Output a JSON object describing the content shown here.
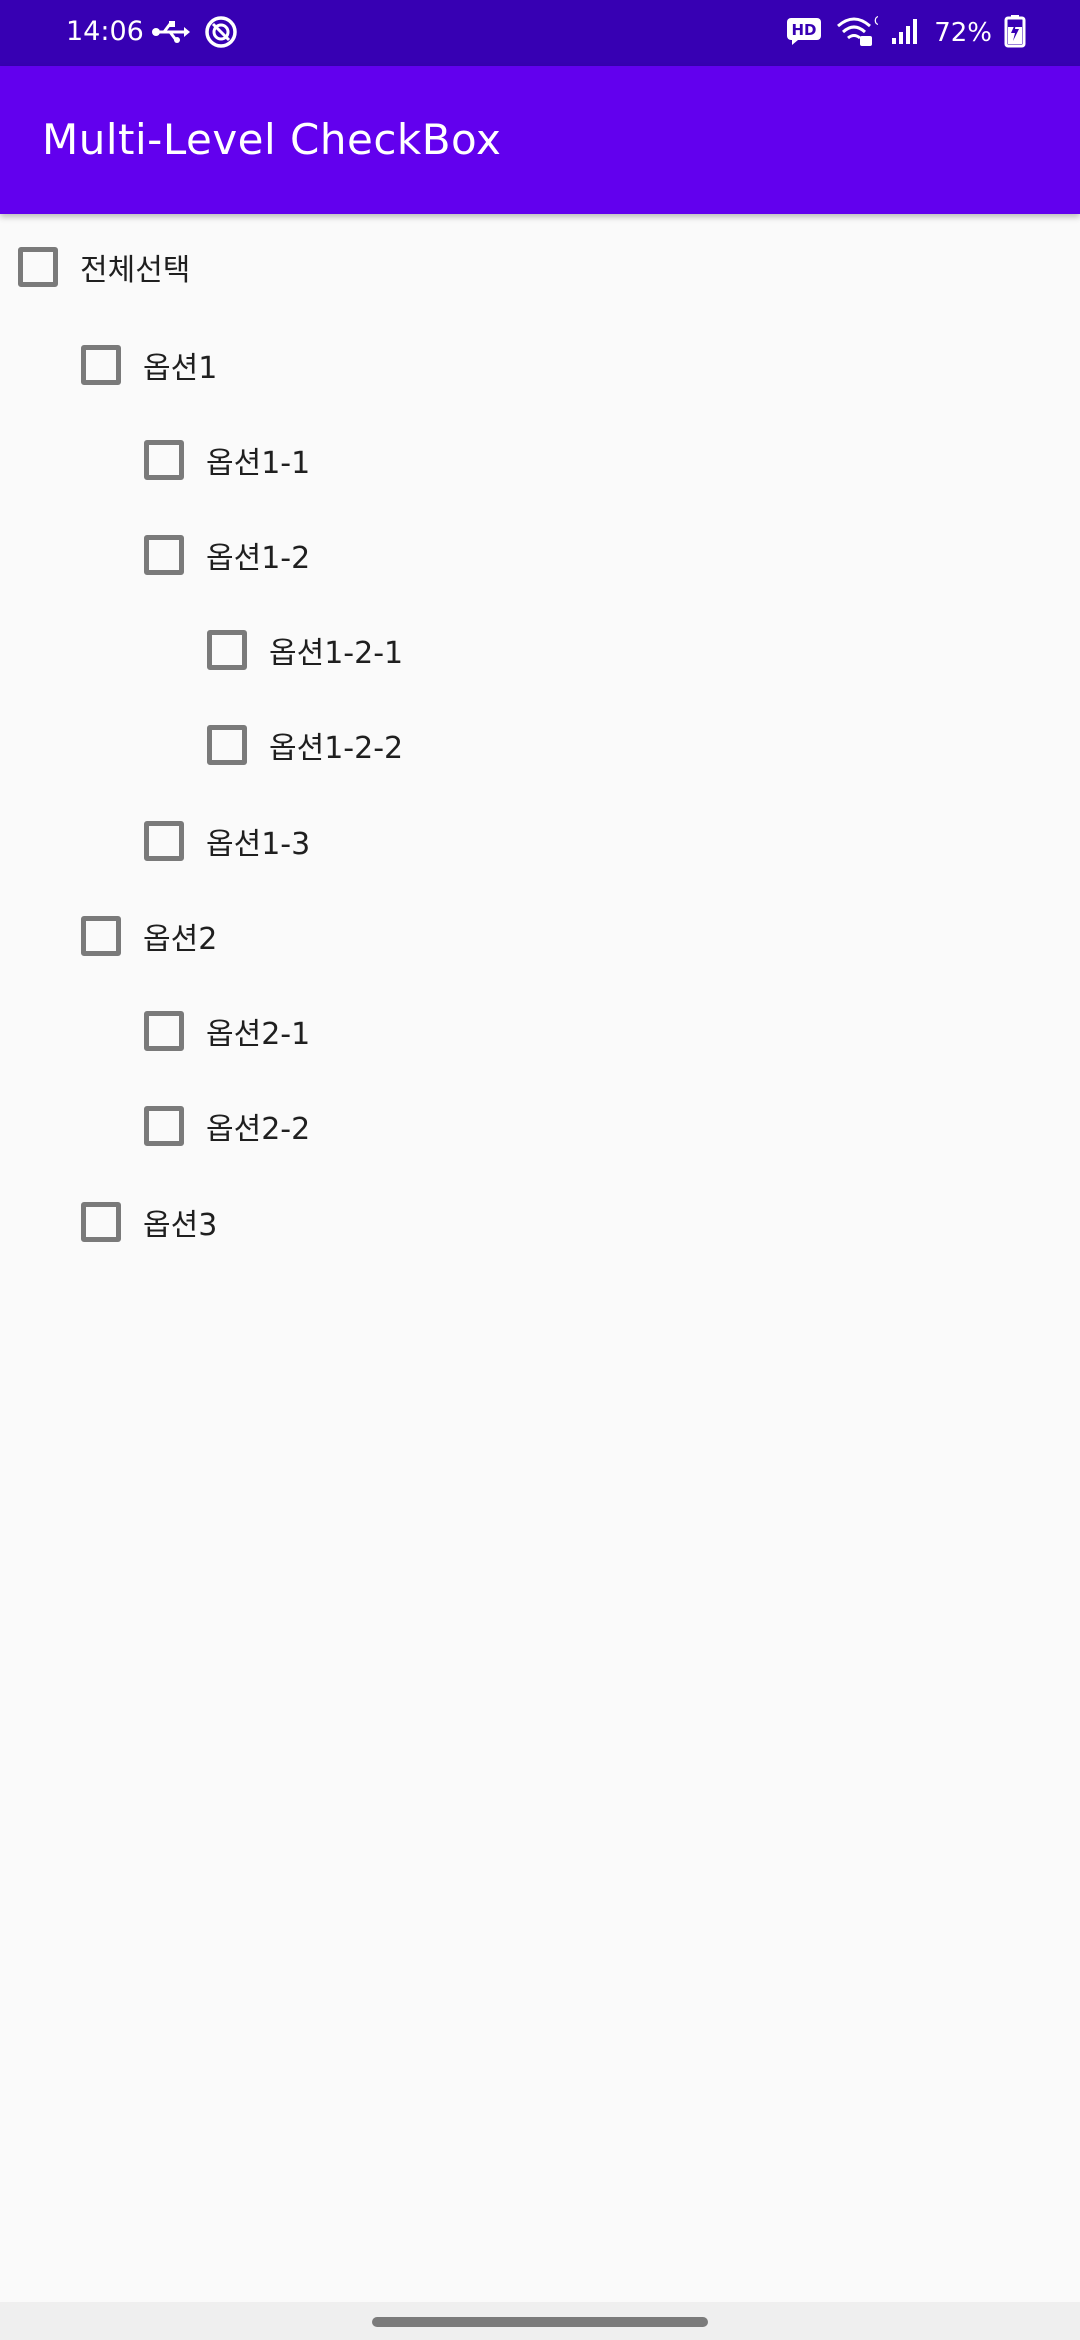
{
  "status_bar": {
    "time": "14:06",
    "battery": "72%",
    "network_type": "G",
    "hd_label": "HD",
    "bg_color": "#3700b3"
  },
  "app_bar": {
    "title": "Multi-Level CheckBox",
    "bg_color": "#6200ee"
  },
  "checklist": [
    {
      "label": "전체선택",
      "level": 0,
      "checked": false
    },
    {
      "label": "옵션1",
      "level": 1,
      "checked": false
    },
    {
      "label": "옵션1-1",
      "level": 2,
      "checked": false
    },
    {
      "label": "옵션1-2",
      "level": 2,
      "checked": false
    },
    {
      "label": "옵션1-2-1",
      "level": 3,
      "checked": false
    },
    {
      "label": "옵션1-2-2",
      "level": 3,
      "checked": false
    },
    {
      "label": "옵션1-3",
      "level": 2,
      "checked": false
    },
    {
      "label": "옵션2",
      "level": 1,
      "checked": false
    },
    {
      "label": "옵션2-1",
      "level": 2,
      "checked": false
    },
    {
      "label": "옵션2-2",
      "level": 2,
      "checked": false
    },
    {
      "label": "옵션3",
      "level": 1,
      "checked": false
    }
  ],
  "icons": {
    "status_left": [
      "usb-icon",
      "data-saver-icon"
    ],
    "status_right": [
      "hd-voice-icon",
      "wifi-calling-icon",
      "signal-icon",
      "battery-charging-icon"
    ]
  }
}
